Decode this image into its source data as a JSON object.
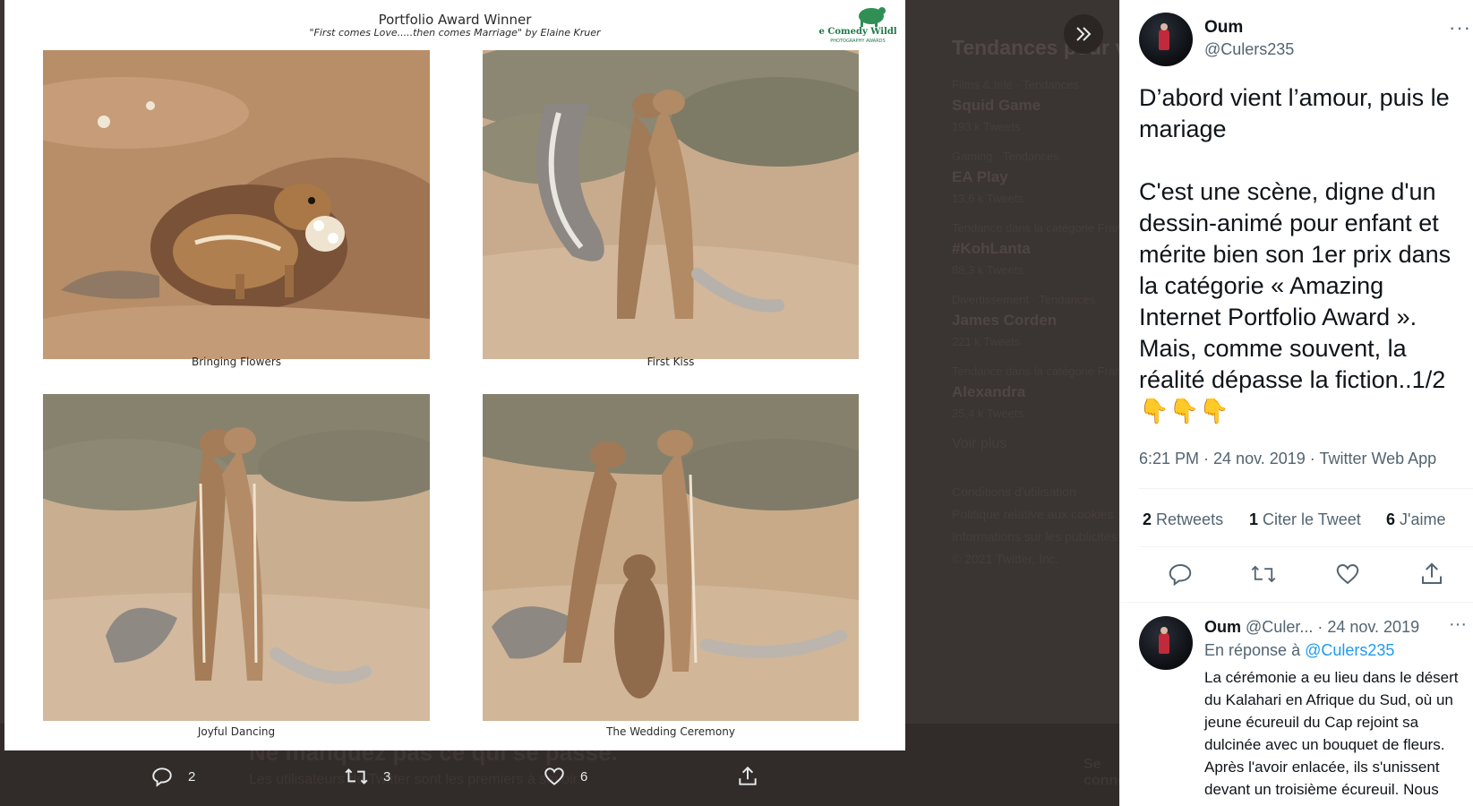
{
  "background": {
    "trends_heading": "Tendances pour vous",
    "trends": [
      {
        "category": "Films & télé · Tendances",
        "name": "Squid Game",
        "count": "193 k Tweets"
      },
      {
        "category": "Gaming · Tendances",
        "name": "EA Play",
        "count": "13,6 k Tweets"
      },
      {
        "category": "Tendance dans la catégorie France",
        "name": "#KohLanta",
        "count": "88,3 k Tweets"
      },
      {
        "category": "Divertissement · Tendances",
        "name": "James Corden",
        "count": "221 k Tweets"
      },
      {
        "category": "Tendance dans la catégorie France",
        "name": "Alexandra",
        "count": "25,4 k Tweets"
      }
    ],
    "show_more": "Voir plus",
    "footer": [
      "Conditions d'utilisation",
      "Politique relative aux cookies",
      "Informations sur les publicités",
      "© 2021 Twitter, Inc."
    ],
    "banner_title": "Ne manquez pas ce qui se passe.",
    "banner_sub": "Les utilisateurs de Twitter sont les premiers à savoir.",
    "banner_button": "Se connecter"
  },
  "media": {
    "award_title": "Portfolio Award Winner",
    "award_subtitle": "\"First comes Love.....then comes Marriage\" by Elaine Kruer",
    "logo_line1": "The Comedy Wildlife",
    "logo_line2": "PHOTOGRAPHY AWARDS",
    "captions": [
      "Bringing Flowers",
      "First Kiss",
      "Joyful Dancing",
      "The Wedding Ceremony"
    ],
    "actions": {
      "replies": "2",
      "retweets": "3",
      "likes": "6"
    },
    "expand_icon": "double-chevron-right-icon"
  },
  "tweet": {
    "author_name": "Oum",
    "author_handle": "@Culers235",
    "text": "D’abord vient l’amour, puis le mariage\n\nC'est une scène, digne d'un dessin-animé pour enfant et mérite bien son 1er prix dans la catégorie « Amazing Internet Portfolio Award ». Mais, comme souvent, la réalité dépasse la fiction..1/2\n👇👇👇",
    "meta": "6:21 PM · 24 nov. 2019 · Twitter Web App",
    "retweets_count": "2",
    "retweets_label": "Retweets",
    "quotes_count": "1",
    "quotes_label": "Citer le Tweet",
    "likes_count": "6",
    "likes_label": "J'aime"
  },
  "reply": {
    "author_name": "Oum",
    "author_handle": "@Culer...",
    "date": "· 24 nov. 2019",
    "reply_to_prefix": "En réponse à",
    "reply_to_handle": "@Culers235",
    "text": "La cérémonie a eu lieu dans le désert du Kalahari en Afrique du Sud, où un jeune écureuil du Cap rejoint sa dulcinée avec un bouquet de fleurs. Après l'avoir enlacée, ils s'unissent devant un troisième écureuil. Nous ignorons cette"
  },
  "colors": {
    "link": "#1d9bf0",
    "overlay_bg": "#36302e",
    "pane_bg": "#ffffff",
    "text_primary": "#0f1419",
    "text_secondary": "#536471"
  }
}
